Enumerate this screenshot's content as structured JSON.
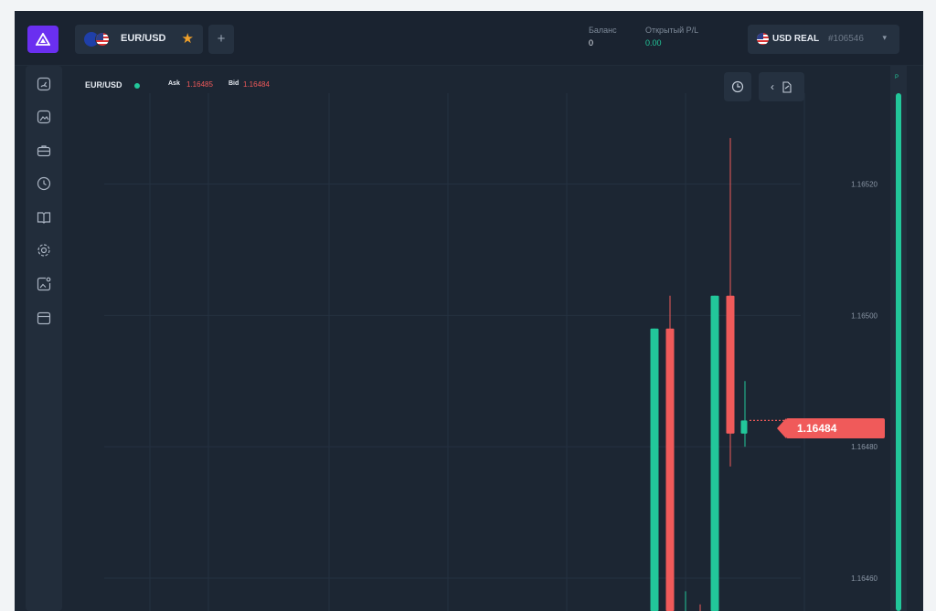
{
  "header": {
    "asset_tab_label": "EUR/USD",
    "add_tab_label": "+",
    "balance": {
      "label": "Баланс",
      "value": "0"
    },
    "pl": {
      "label": "Открытый P/L",
      "value": "0.00"
    },
    "account": {
      "name": "USD REAL",
      "id": "#106546",
      "caret": "▾"
    }
  },
  "sidebar": {
    "icons": [
      "gauge-icon",
      "image-icon",
      "briefcase-icon",
      "clock-icon",
      "book-icon",
      "settings-icon",
      "add-image-icon",
      "calendar-icon"
    ]
  },
  "chart_info": {
    "symbol": "EUR/USD",
    "ask_label": "Ask",
    "ask_value": "1.16485",
    "bid_label": "Bid",
    "bid_value": "1.16484"
  },
  "price_tag": "1.16484",
  "rail_label": "P",
  "colors": {
    "up": "#22c79a",
    "down": "#f05a5a",
    "accent": "#6a2ff0",
    "star": "#f0a02a"
  },
  "chart_data": {
    "type": "candlestick",
    "y_ticks": [
      1.1652,
      1.165,
      1.1648,
      1.1646
    ],
    "y_tick_labels": [
      "1.16520",
      "1.16500",
      "1.16480",
      "1.16460"
    ],
    "ylim": [
      1.16455,
      1.16538
    ],
    "current_price": 1.16484,
    "candles": [
      {
        "open": 1.16453,
        "high": 1.16498,
        "low": 1.1644,
        "close": 1.16498
      },
      {
        "open": 1.16498,
        "high": 1.16503,
        "low": 1.1644,
        "close": 1.1644
      },
      {
        "open": 1.16453,
        "high": 1.16458,
        "low": 1.16448,
        "close": 1.16455
      },
      {
        "open": 1.16455,
        "high": 1.16456,
        "low": 1.1644,
        "close": 1.1645
      },
      {
        "open": 1.1644,
        "high": 1.16503,
        "low": 1.1644,
        "close": 1.16503
      },
      {
        "open": 1.16503,
        "high": 1.16527,
        "low": 1.16477,
        "close": 1.16482
      },
      {
        "open": 1.16482,
        "high": 1.1649,
        "low": 1.1648,
        "close": 1.16484
      }
    ]
  }
}
